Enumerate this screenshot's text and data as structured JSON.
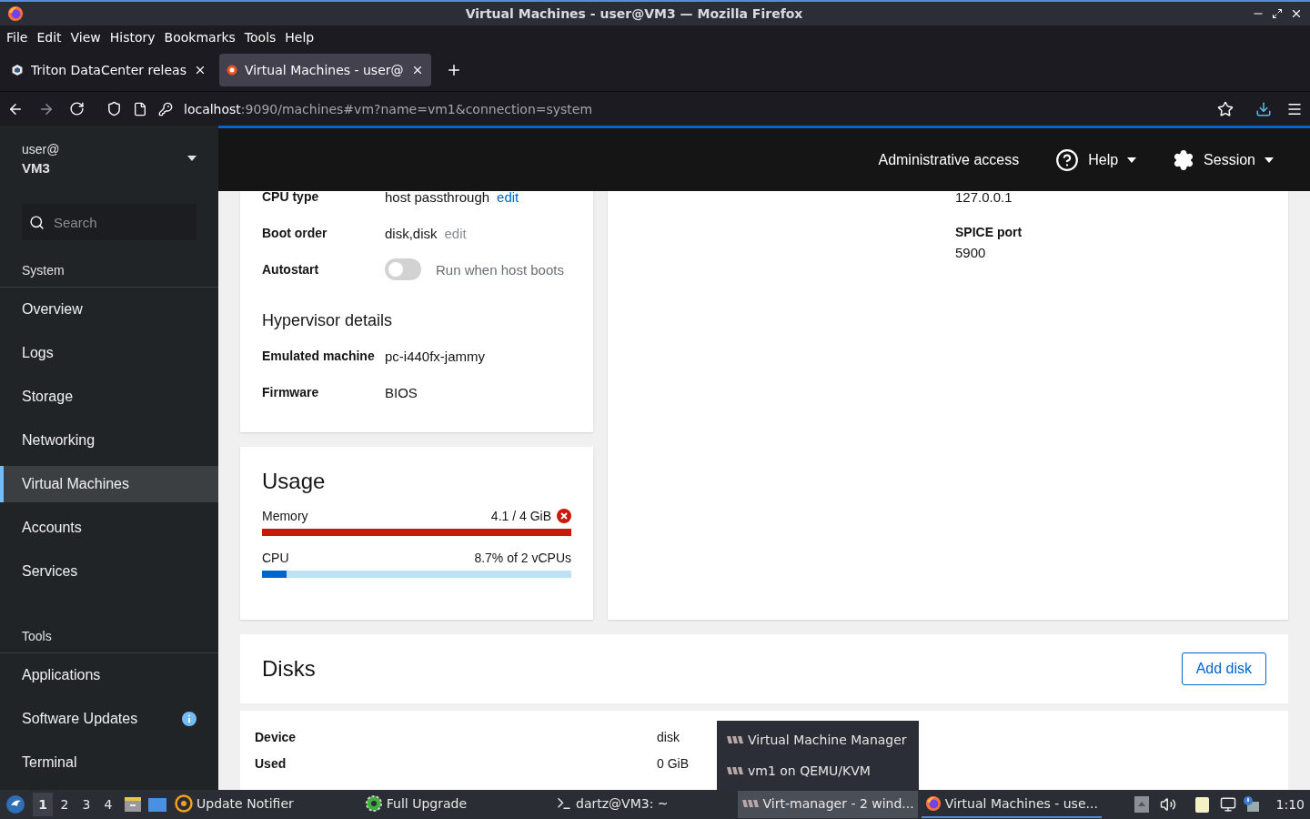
{
  "window": {
    "title": "Virtual Machines - user@VM3 — Mozilla Firefox"
  },
  "menu": [
    {
      "label": "File"
    },
    {
      "label": "Edit"
    },
    {
      "label": "View"
    },
    {
      "label": "History"
    },
    {
      "label": "Bookmarks"
    },
    {
      "label": "Tools"
    },
    {
      "label": "Help"
    }
  ],
  "tabs": [
    {
      "label": "Triton DataCenter releas",
      "selected": false
    },
    {
      "label": "Virtual Machines - user@",
      "selected": true
    }
  ],
  "url": {
    "host": "localhost",
    "rest": ":9090/machines#vm?name=vm1&connection=system"
  },
  "sidebar": {
    "user": "user@",
    "host": "VM3",
    "search": {
      "placeholder": "Search"
    },
    "sections": [
      {
        "title": "System",
        "items": [
          {
            "label": "Overview",
            "selected": false
          },
          {
            "label": "Logs",
            "selected": false
          },
          {
            "label": "Storage",
            "selected": false
          },
          {
            "label": "Networking",
            "selected": false
          },
          {
            "label": "Virtual Machines",
            "selected": true
          },
          {
            "label": "Accounts",
            "selected": false
          },
          {
            "label": "Services",
            "selected": false
          }
        ]
      },
      {
        "title": "Tools",
        "items": [
          {
            "label": "Applications",
            "selected": false
          },
          {
            "label": "Software Updates",
            "selected": false,
            "badge": true
          },
          {
            "label": "Terminal",
            "selected": false
          }
        ]
      }
    ]
  },
  "header": {
    "admin": "Administrative access",
    "help": "Help",
    "session": "Session"
  },
  "details": [
    {
      "label": "CPU type",
      "value": "host passthrough",
      "edit": {
        "label": "edit",
        "disabled": false
      }
    },
    {
      "label": "Boot order",
      "value": "disk,disk",
      "edit": {
        "label": "edit",
        "disabled": true
      }
    },
    {
      "label": "Autostart",
      "toggle": {
        "on": false,
        "label": "Run when host boots"
      }
    }
  ],
  "hypervisor": {
    "title": "Hypervisor details",
    "rows": [
      {
        "label": "Emulated machine",
        "value": "pc-i440fx-jammy"
      },
      {
        "label": "Firmware",
        "value": "BIOS"
      }
    ]
  },
  "console": {
    "address": "127.0.0.1",
    "rows": [
      {
        "label": "SPICE port",
        "value": "5900"
      }
    ]
  },
  "usage": {
    "title": "Usage",
    "meters": [
      {
        "label": "Memory",
        "reading": "4.1 / 4 GiB",
        "level": 1,
        "over_limit": true
      },
      {
        "label": "CPU",
        "reading": "8.7% of 2 vCPUs",
        "level": 0.08,
        "over_limit": false
      }
    ]
  },
  "disks": {
    "title": "Disks",
    "add": "Add disk",
    "rows": [
      {
        "label": "Device",
        "value": "disk"
      },
      {
        "label": "Used",
        "value": "0 GiB"
      }
    ]
  },
  "popup": {
    "items": [
      {
        "label": "Virtual Machine Manager"
      },
      {
        "label": "vm1 on QEMU/KVM"
      }
    ]
  },
  "taskbar": {
    "workspaces": [
      {
        "label": "1",
        "selected": true
      },
      {
        "label": "2",
        "selected": false
      },
      {
        "label": "3",
        "selected": false
      },
      {
        "label": "4",
        "selected": false
      }
    ],
    "tasks": [
      {
        "kind": "notifier",
        "label": "Update Notifier",
        "selected": false
      },
      {
        "kind": "upgrade",
        "label": "Full Upgrade",
        "selected": false
      },
      {
        "kind": "terminal",
        "label": "dartz@VM3: ~",
        "selected": false
      },
      {
        "kind": "virt",
        "label": "Virt-manager - 2 wind...",
        "selected": false,
        "hovered": true
      },
      {
        "kind": "firefox",
        "label": "Virtual Machines - use...",
        "selected": true
      }
    ],
    "clock": "1:10"
  }
}
